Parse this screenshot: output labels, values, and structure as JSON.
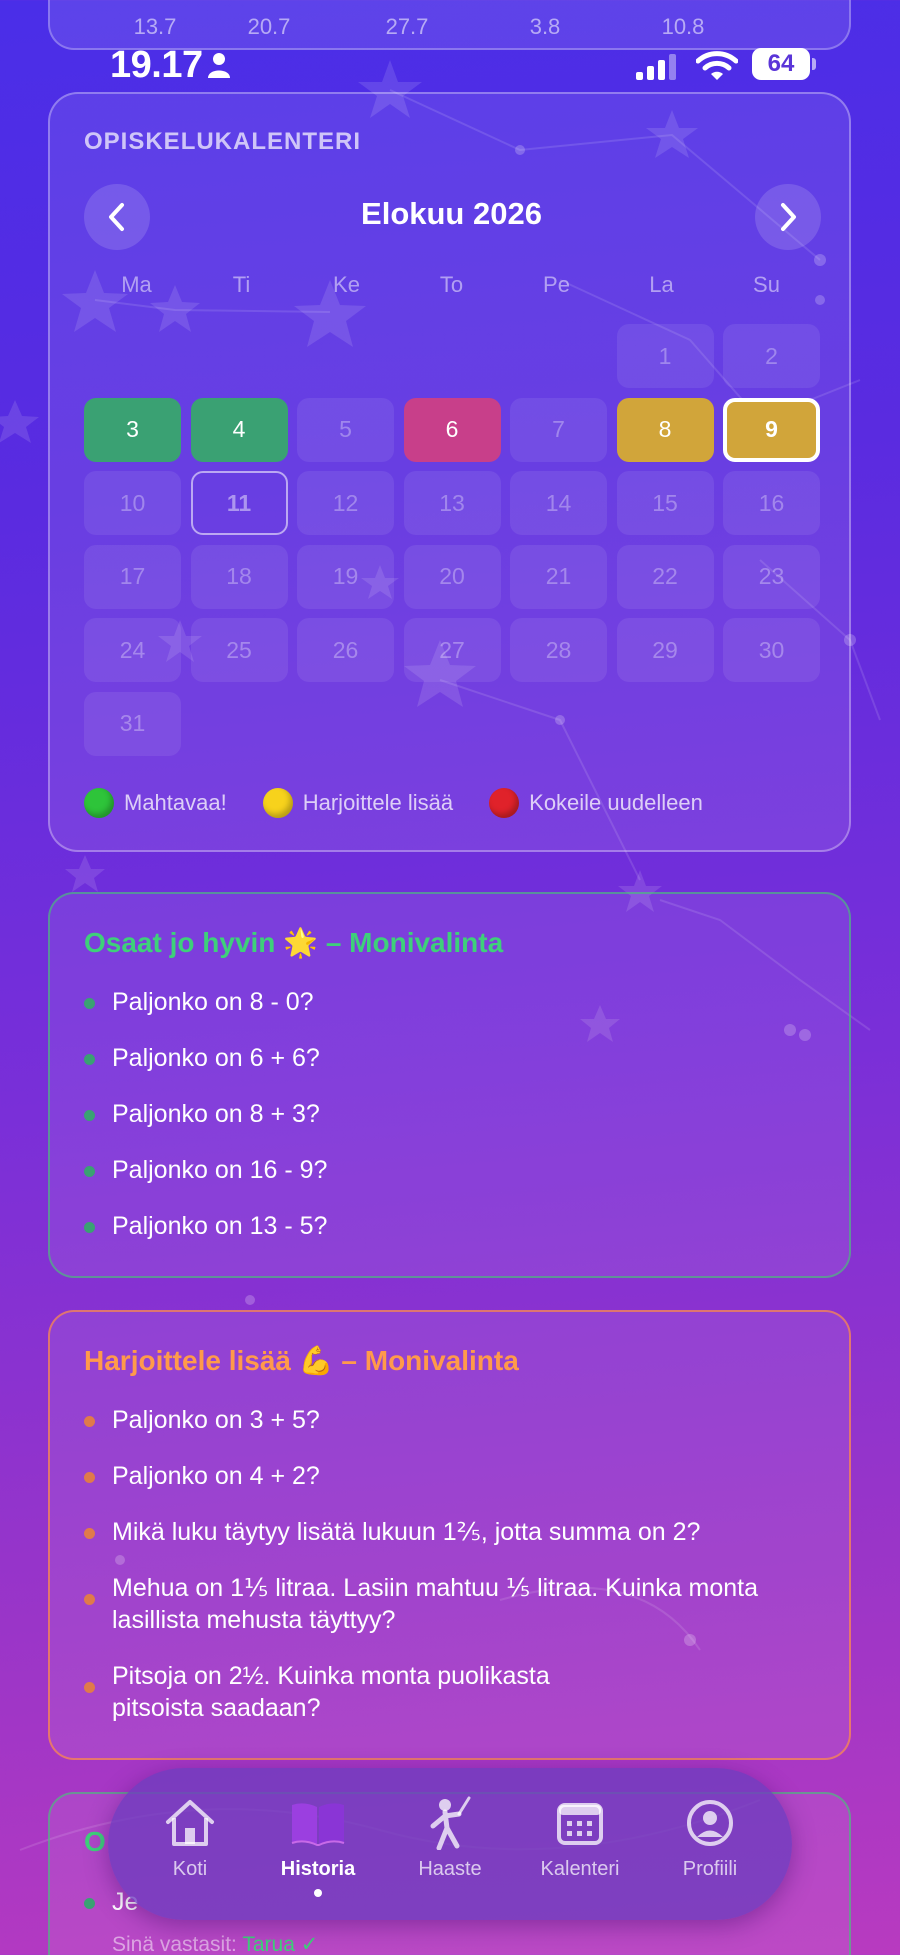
{
  "top_card": {
    "values": [
      "13.7",
      "20.7",
      "27.7",
      "3.8",
      "10.8"
    ]
  },
  "status_bar": {
    "time": "19.17",
    "battery": "64"
  },
  "calendar": {
    "title": "OPISKELUKALENTERI",
    "month": "Elokuu 2026",
    "weekdays": [
      "Ma",
      "Ti",
      "Ke",
      "To",
      "Pe",
      "La",
      "Su"
    ],
    "days": [
      {
        "day": "1",
        "state": "empty"
      },
      {
        "day": "2",
        "state": "empty"
      },
      {
        "day": "3",
        "state": "green"
      },
      {
        "day": "4",
        "state": "green"
      },
      {
        "day": "5",
        "state": "empty"
      },
      {
        "day": "6",
        "state": "red"
      },
      {
        "day": "7",
        "state": "empty"
      },
      {
        "day": "8",
        "state": "yellow"
      },
      {
        "day": "9",
        "state": "yellow-selected"
      },
      {
        "day": "10",
        "state": "empty"
      },
      {
        "day": "11",
        "state": "today"
      },
      {
        "day": "12",
        "state": "empty"
      },
      {
        "day": "13",
        "state": "empty"
      },
      {
        "day": "14",
        "state": "empty"
      },
      {
        "day": "15",
        "state": "empty"
      },
      {
        "day": "16",
        "state": "empty"
      },
      {
        "day": "17",
        "state": "empty"
      },
      {
        "day": "18",
        "state": "empty"
      },
      {
        "day": "19",
        "state": "empty"
      },
      {
        "day": "20",
        "state": "empty"
      },
      {
        "day": "21",
        "state": "empty"
      },
      {
        "day": "22",
        "state": "empty"
      },
      {
        "day": "23",
        "state": "empty"
      },
      {
        "day": "24",
        "state": "empty"
      },
      {
        "day": "25",
        "state": "empty"
      },
      {
        "day": "26",
        "state": "empty"
      },
      {
        "day": "27",
        "state": "empty"
      },
      {
        "day": "28",
        "state": "empty"
      },
      {
        "day": "29",
        "state": "empty"
      },
      {
        "day": "30",
        "state": "empty"
      },
      {
        "day": "31",
        "state": "empty"
      }
    ],
    "legend": [
      {
        "label": "Mahtavaa!",
        "color": "#2ec43a"
      },
      {
        "label": "Harjoittele lisää",
        "color": "#f7d21c"
      },
      {
        "label": "Kokeile uudelleen",
        "color": "#e0222a"
      }
    ]
  },
  "topics": {
    "good": {
      "title": "Osaat jo hyvin 🌟 – Monivalinta",
      "items": [
        "Paljonko on 8 - 0?",
        "Paljonko on 6 + 6?",
        "Paljonko on 8 + 3?",
        "Paljonko on 16 - 9?",
        "Paljonko on 13 - 5?"
      ]
    },
    "practice": {
      "title": "Harjoittele lisää 💪 – Monivalinta",
      "items": [
        "Paljonko on 3 + 5?",
        "Paljonko on 4 + 2?",
        "Mikä luku täytyy lisätä lukuun 1⅖, jotta summa on 2?",
        "Mehua on 1⅕ litraa. Lasiin mahtuu ⅕ litraa. Kuinka monta lasillista mehusta täyttyy?",
        "Pitsoja on 2½. Kuinka monta puolikasta pitsoista saadaan?"
      ]
    },
    "third": {
      "title": "O",
      "items": [
        "Je"
      ],
      "answer_label": "Sinä vastasit:",
      "answer_value": "Tarua ✓"
    }
  },
  "tabbar": {
    "tabs": [
      {
        "label": "Koti",
        "icon": "home-icon"
      },
      {
        "label": "Historia",
        "icon": "book-icon",
        "active": true
      },
      {
        "label": "Haaste",
        "icon": "fencer-icon"
      },
      {
        "label": "Kalenteri",
        "icon": "calendar-icon"
      },
      {
        "label": "Profiili",
        "icon": "profile-icon"
      }
    ]
  }
}
